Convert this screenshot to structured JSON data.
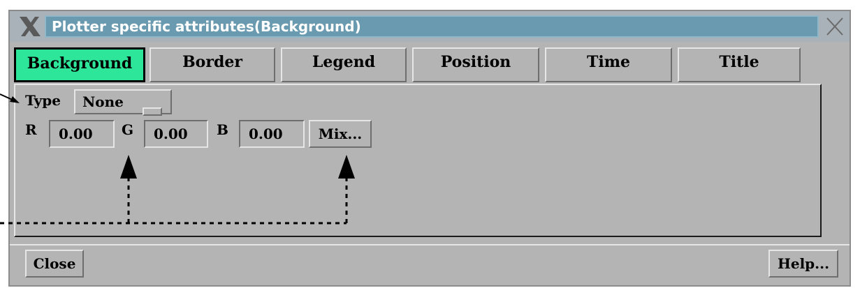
{
  "window": {
    "title": "Plotter specific attributes(Background)"
  },
  "tabs": [
    {
      "label": "Background"
    },
    {
      "label": "Border"
    },
    {
      "label": "Legend"
    },
    {
      "label": "Position"
    },
    {
      "label": "Time"
    },
    {
      "label": "Title"
    }
  ],
  "type_row": {
    "label": "Type",
    "value": "None"
  },
  "color": {
    "r_label": "R",
    "r_value": "0.00",
    "g_label": "G",
    "g_value": "0.00",
    "b_label": "B",
    "b_value": "0.00",
    "mix_label": "Mix..."
  },
  "footer": {
    "close_label": "Close",
    "help_label": "Help..."
  },
  "colors": {
    "active_tab": "#2ee69a",
    "title_bar": "#6a9aaf",
    "background": "#b4b4b4"
  },
  "icons": [
    "x-window-logo-icon",
    "close-window-icon",
    "option-menu-indicator-icon"
  ]
}
